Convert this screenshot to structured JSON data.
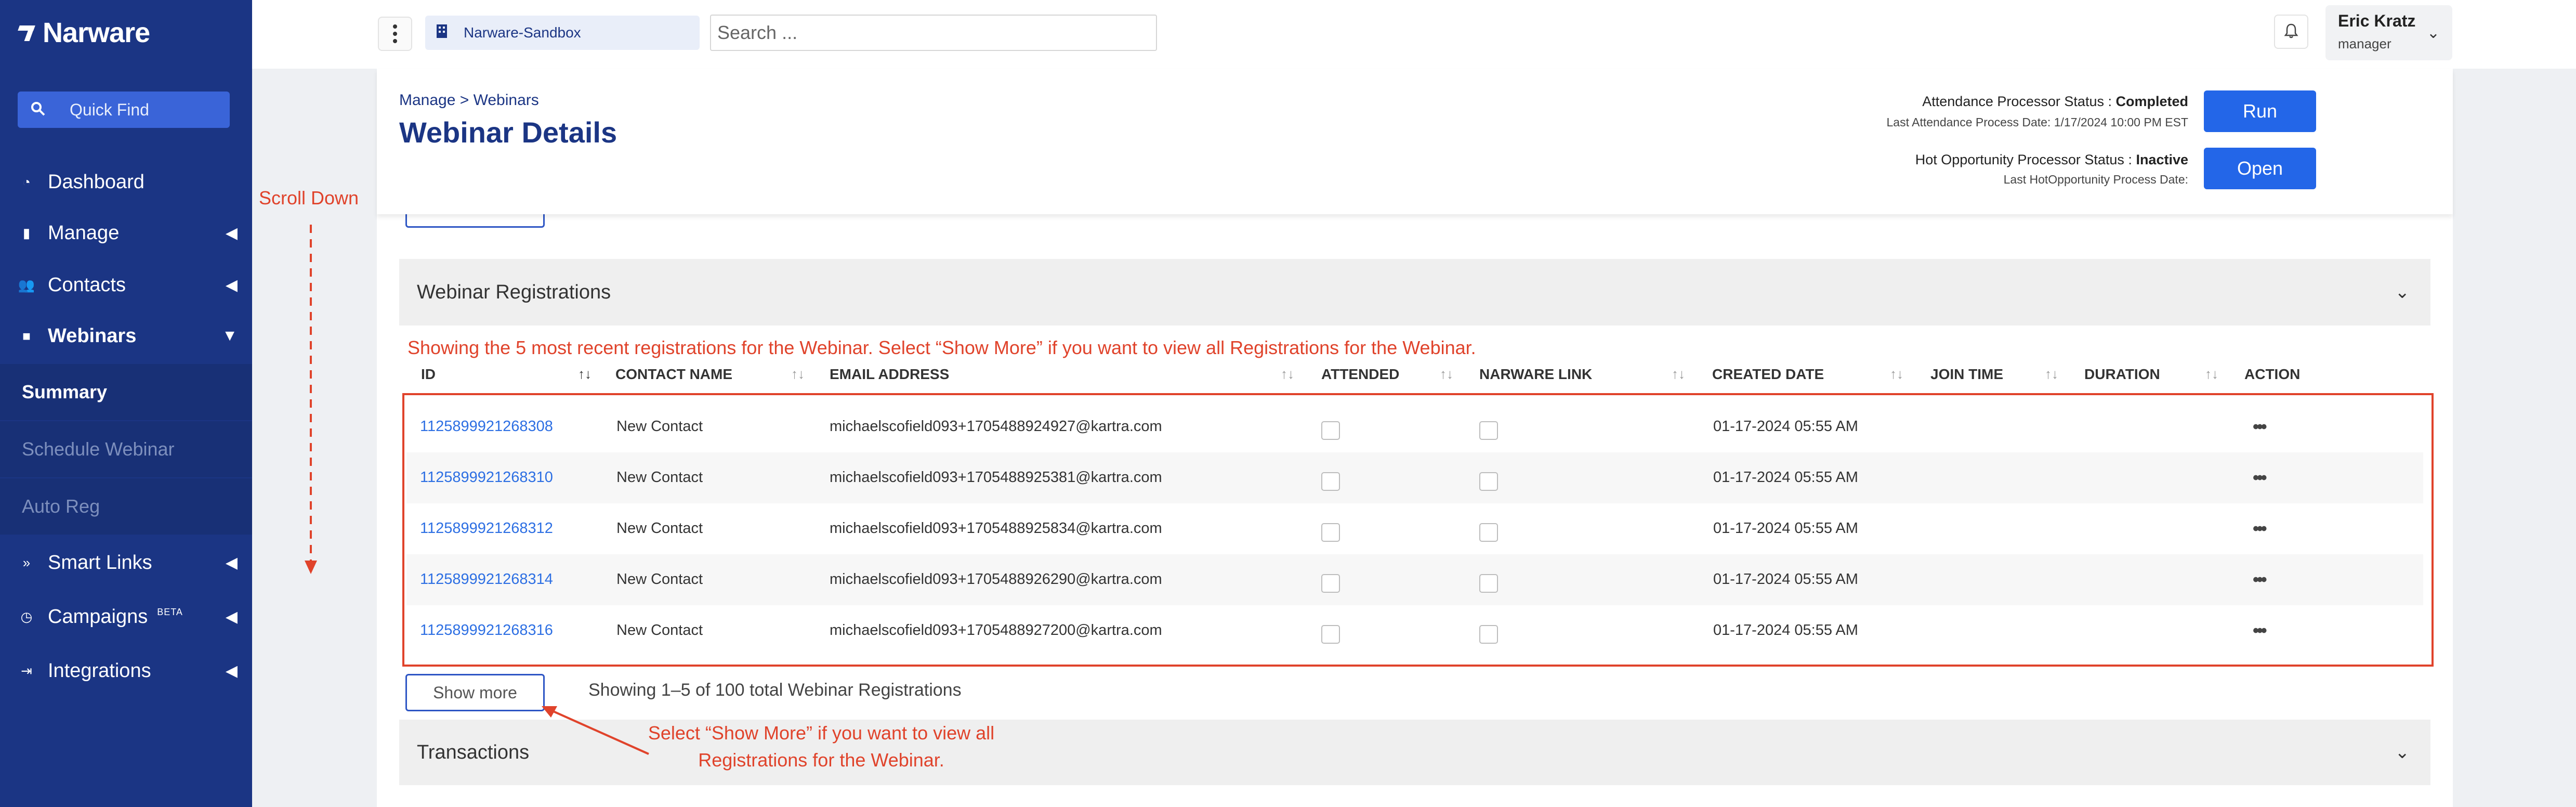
{
  "sidebar": {
    "logo": "Narware",
    "quick_find": "Quick Find",
    "items": [
      {
        "label": "Dashboard",
        "icon": "gauge-icon"
      },
      {
        "label": "Manage",
        "icon": "building-icon"
      },
      {
        "label": "Contacts",
        "icon": "users-icon"
      },
      {
        "label": "Webinars",
        "icon": "video-icon"
      },
      {
        "label": "Smart Links",
        "icon": "double-chevron-icon"
      },
      {
        "label": "Campaigns",
        "icon": "clock-icon",
        "badge": "BETA"
      },
      {
        "label": "Integrations",
        "icon": "sign-in-icon"
      }
    ],
    "webinar_sub": [
      "Summary",
      "Schedule Webinar",
      "Auto Reg"
    ]
  },
  "topbar": {
    "tenant": "Narware-Sandbox",
    "search_placeholder": "Search ...",
    "user_name": "Eric Kratz",
    "user_role": "manager"
  },
  "header": {
    "breadcrumb": "Manage > Webinars",
    "title": "Webinar Details",
    "attendance_status_label": "Attendance Processor Status :",
    "attendance_status_value": "Completed",
    "last_attendance": "Last Attendance Process Date: 1/17/2024 10:00 PM EST",
    "run_label": "Run",
    "hot_status_label": "Hot Opportunity Processor Status :",
    "hot_status_value": "Inactive",
    "last_hot": "Last HotOpportunity Process Date:",
    "open_label": "Open"
  },
  "registrations": {
    "section_title": "Webinar Registrations",
    "notice": "Showing the 5 most recent registrations for the Webinar. Select “Show More” if you want to view all Registrations for the Webinar.",
    "columns": [
      "ID",
      "CONTACT NAME",
      "EMAIL ADDRESS",
      "ATTENDED",
      "NARWARE LINK",
      "CREATED DATE",
      "JOIN TIME",
      "DURATION",
      "ACTION"
    ],
    "rows": [
      {
        "id": "1125899921268308",
        "name": "New Contact",
        "email": "michaelscofield093+1705488924927@kartra.com",
        "created": "01-17-2024 05:55 AM"
      },
      {
        "id": "1125899921268310",
        "name": "New Contact",
        "email": "michaelscofield093+1705488925381@kartra.com",
        "created": "01-17-2024 05:55 AM"
      },
      {
        "id": "1125899921268312",
        "name": "New Contact",
        "email": "michaelscofield093+1705488925834@kartra.com",
        "created": "01-17-2024 05:55 AM"
      },
      {
        "id": "1125899921268314",
        "name": "New Contact",
        "email": "michaelscofield093+1705488926290@kartra.com",
        "created": "01-17-2024 05:55 AM"
      },
      {
        "id": "1125899921268316",
        "name": "New Contact",
        "email": "michaelscofield093+1705488927200@kartra.com",
        "created": "01-17-2024 05:55 AM"
      }
    ],
    "show_more": "Show more",
    "showing": "Showing 1–5 of 100 total Webinar Registrations"
  },
  "transactions": {
    "section_title": "Transactions"
  },
  "annotations": {
    "scroll_down": "Scroll Down",
    "show_more_hint": "Select “Show More” if you want to view all Registrations for the Webinar.",
    "accent_color": "#e0432b"
  },
  "colors": {
    "sidebar": "#1b3584",
    "primary": "#2366e8",
    "link": "#2d6fe3"
  }
}
